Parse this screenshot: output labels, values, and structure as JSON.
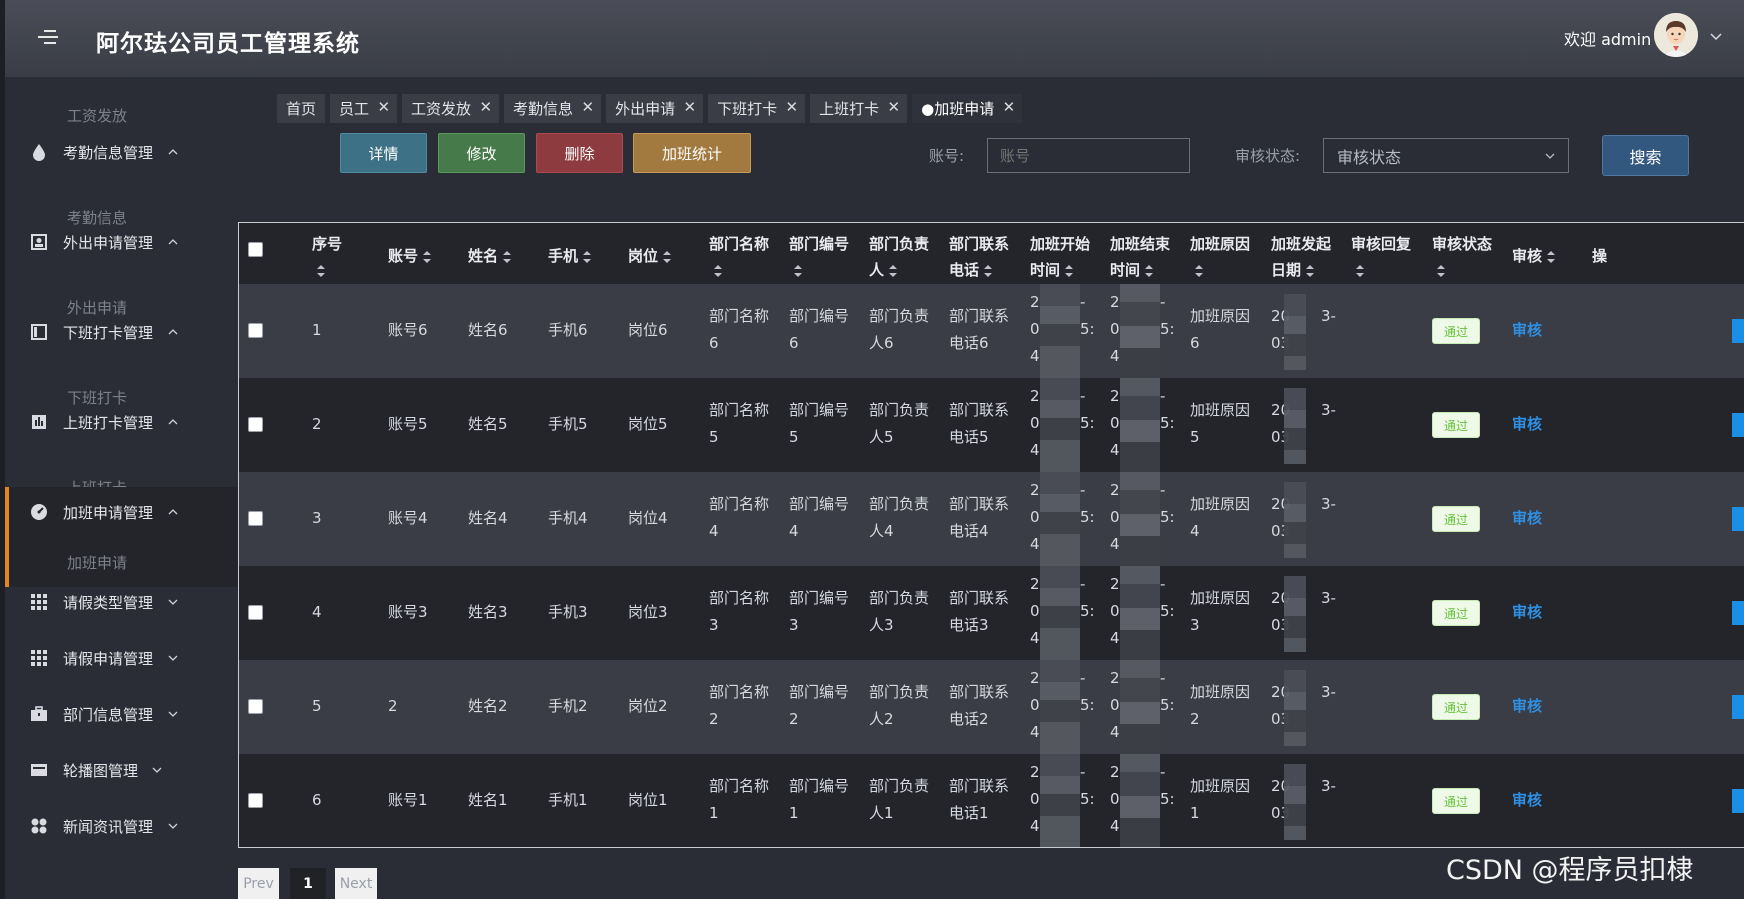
{
  "header": {
    "title": "阿尔珐公司员工管理系统",
    "welcome": "欢迎 admin"
  },
  "sidebar": {
    "items": [
      {
        "label": "工资发放",
        "kind": "sub"
      },
      {
        "label": "考勤信息管理",
        "kind": "group",
        "icon": "drop-icon",
        "expanded": true
      },
      {
        "label": "考勤信息",
        "kind": "sub"
      },
      {
        "label": "外出申请管理",
        "kind": "group",
        "icon": "portrait-icon",
        "expanded": true
      },
      {
        "label": "外出申请",
        "kind": "sub"
      },
      {
        "label": "下班打卡管理",
        "kind": "group",
        "icon": "panel-icon",
        "expanded": true
      },
      {
        "label": "下班打卡",
        "kind": "sub"
      },
      {
        "label": "上班打卡管理",
        "kind": "group",
        "icon": "bars-icon",
        "expanded": true
      },
      {
        "label": "上班打卡",
        "kind": "sub"
      },
      {
        "label": "加班申请管理",
        "kind": "group",
        "icon": "gauge-icon",
        "expanded": true,
        "active": true
      },
      {
        "label": "加班申请",
        "kind": "sub",
        "active": true
      },
      {
        "label": "请假类型管理",
        "kind": "group",
        "icon": "grid-icon",
        "expanded": false
      },
      {
        "label": "请假申请管理",
        "kind": "group",
        "icon": "grid-icon",
        "expanded": false
      },
      {
        "label": "部门信息管理",
        "kind": "group",
        "icon": "briefcase-icon",
        "expanded": false
      },
      {
        "label": "轮播图管理",
        "kind": "group",
        "icon": "card-icon",
        "expanded": false
      },
      {
        "label": "新闻资讯管理",
        "kind": "group",
        "icon": "apps-icon",
        "expanded": false
      }
    ]
  },
  "tabs": [
    {
      "label": "首页",
      "closable": false
    },
    {
      "label": "员工",
      "closable": true
    },
    {
      "label": "工资发放",
      "closable": true
    },
    {
      "label": "考勤信息",
      "closable": true
    },
    {
      "label": "外出申请",
      "closable": true
    },
    {
      "label": "下班打卡",
      "closable": true
    },
    {
      "label": "上班打卡",
      "closable": true
    },
    {
      "label": "●加班申请",
      "closable": true,
      "current": true
    }
  ],
  "toolbar": {
    "detail": "详情",
    "edit": "修改",
    "delete": "删除",
    "stats": "加班统计"
  },
  "search": {
    "account_label": "账号:",
    "account_placeholder": "账号",
    "status_label": "审核状态:",
    "status_value": "审核状态",
    "search_button": "搜索"
  },
  "table": {
    "headers": [
      "序号",
      "账号",
      "姓名",
      "手机",
      "岗位",
      "部门名称",
      "部门编号",
      "部门负责人",
      "部门联系电话",
      "加班开始时间",
      "加班结束时间",
      "加班原因",
      "加班发起日期",
      "审核回复",
      "审核状态",
      "审核",
      "操"
    ],
    "headers_wrapped": {
      "部门名称": [
        "部门名称",
        ""
      ],
      "部门编号": [
        "部门编号",
        ""
      ],
      "部门负责人": [
        "部门负责",
        "人"
      ],
      "部门联系电话": [
        "部门联系",
        "电话"
      ],
      "加班开始时间": [
        "加班开始",
        "时间"
      ],
      "加班结束时间": [
        "加班结束",
        "时间"
      ],
      "加班原因": [
        "加班原因",
        ""
      ],
      "加班发起日期": [
        "加班发起",
        "日期"
      ],
      "审核回复": [
        "审核回复",
        ""
      ],
      "审核状态": [
        "审核状态",
        ""
      ]
    },
    "rows": [
      {
        "seq": "1",
        "account": "账号6",
        "name": "姓名6",
        "phone": "手机6",
        "post": "岗位6",
        "dept_name": [
          "部门名称",
          "6"
        ],
        "dept_no": [
          "部门编号",
          "6"
        ],
        "dept_head": [
          "部门负责",
          "人6"
        ],
        "dept_tel": [
          "部门联系",
          "电话6"
        ],
        "start": [
          "2",
          "0",
          "4"
        ],
        "start_tail": [
          "-",
          "5:",
          ""
        ],
        "end": [
          "2",
          "0",
          "4"
        ],
        "end_tail": [
          "-",
          "5:",
          ""
        ],
        "reason": [
          "加班原因",
          "6"
        ],
        "date": [
          "20",
          "03"
        ],
        "date_tail": "3-",
        "reply": "",
        "status": "通过",
        "audit": "审核"
      },
      {
        "seq": "2",
        "account": "账号5",
        "name": "姓名5",
        "phone": "手机5",
        "post": "岗位5",
        "dept_name": [
          "部门名称",
          "5"
        ],
        "dept_no": [
          "部门编号",
          "5"
        ],
        "dept_head": [
          "部门负责",
          "人5"
        ],
        "dept_tel": [
          "部门联系",
          "电话5"
        ],
        "start": [
          "2",
          "0",
          "4"
        ],
        "start_tail": [
          "-",
          "5:",
          ""
        ],
        "end": [
          "2",
          "0",
          "4"
        ],
        "end_tail": [
          "-",
          "5:",
          ""
        ],
        "reason": [
          "加班原因",
          "5"
        ],
        "date": [
          "20",
          "03"
        ],
        "date_tail": "3-",
        "reply": "",
        "status": "通过",
        "audit": "审核"
      },
      {
        "seq": "3",
        "account": "账号4",
        "name": "姓名4",
        "phone": "手机4",
        "post": "岗位4",
        "dept_name": [
          "部门名称",
          "4"
        ],
        "dept_no": [
          "部门编号",
          "4"
        ],
        "dept_head": [
          "部门负责",
          "人4"
        ],
        "dept_tel": [
          "部门联系",
          "电话4"
        ],
        "start": [
          "2",
          "0",
          "4"
        ],
        "start_tail": [
          "-",
          "5:",
          ""
        ],
        "end": [
          "2",
          "0",
          "4"
        ],
        "end_tail": [
          "-",
          "5:",
          ""
        ],
        "reason": [
          "加班原因",
          "4"
        ],
        "date": [
          "20",
          "03"
        ],
        "date_tail": "3-",
        "reply": "",
        "status": "通过",
        "audit": "审核"
      },
      {
        "seq": "4",
        "account": "账号3",
        "name": "姓名3",
        "phone": "手机3",
        "post": "岗位3",
        "dept_name": [
          "部门名称",
          "3"
        ],
        "dept_no": [
          "部门编号",
          "3"
        ],
        "dept_head": [
          "部门负责",
          "人3"
        ],
        "dept_tel": [
          "部门联系",
          "电话3"
        ],
        "start": [
          "2",
          "0",
          "4"
        ],
        "start_tail": [
          "-",
          "5:",
          ""
        ],
        "end": [
          "2",
          "0",
          "4"
        ],
        "end_tail": [
          "-",
          "5:",
          ""
        ],
        "reason": [
          "加班原因",
          "3"
        ],
        "date": [
          "20",
          "03"
        ],
        "date_tail": "3-",
        "reply": "",
        "status": "通过",
        "audit": "审核"
      },
      {
        "seq": "5",
        "account": "2",
        "name": "姓名2",
        "phone": "手机2",
        "post": "岗位2",
        "dept_name": [
          "部门名称",
          "2"
        ],
        "dept_no": [
          "部门编号",
          "2"
        ],
        "dept_head": [
          "部门负责",
          "人2"
        ],
        "dept_tel": [
          "部门联系",
          "电话2"
        ],
        "start": [
          "2",
          "0",
          "4"
        ],
        "start_tail": [
          "-",
          "5:",
          ""
        ],
        "end": [
          "2",
          "0",
          "4"
        ],
        "end_tail": [
          "-",
          "5:",
          ""
        ],
        "reason": [
          "加班原因",
          "2"
        ],
        "date": [
          "20",
          "03"
        ],
        "date_tail": "3-",
        "reply": "",
        "status": "通过",
        "audit": "审核"
      },
      {
        "seq": "6",
        "account": "账号1",
        "name": "姓名1",
        "phone": "手机1",
        "post": "岗位1",
        "dept_name": [
          "部门名称",
          "1"
        ],
        "dept_no": [
          "部门编号",
          "1"
        ],
        "dept_head": [
          "部门负责",
          "人1"
        ],
        "dept_tel": [
          "部门联系",
          "电话1"
        ],
        "start": [
          "2",
          "0",
          "4"
        ],
        "start_tail": [
          "-",
          "5:",
          ""
        ],
        "end": [
          "2",
          "0",
          "4"
        ],
        "end_tail": [
          "-",
          "5:",
          ""
        ],
        "reason": [
          "加班原因",
          "1"
        ],
        "date": [
          "20",
          "03"
        ],
        "date_tail": "3-",
        "reply": "",
        "status": "通过",
        "audit": "审核"
      }
    ]
  },
  "pagination": {
    "prev": "Prev",
    "current": "1",
    "next": "Next"
  },
  "watermark": "CSDN @程序员扣棣",
  "colors": {
    "accent": "#e6841f",
    "link": "#2e8fe3",
    "success": "#67c23a"
  }
}
